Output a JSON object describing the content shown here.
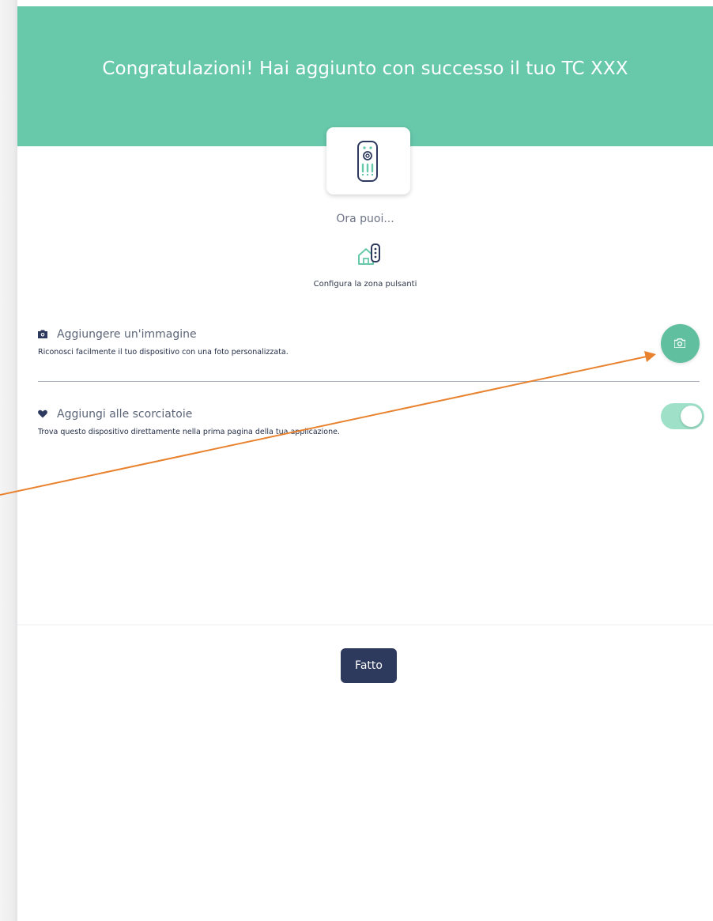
{
  "header": {
    "title": "Congratulazioni! Hai aggiunto con successo il tuo TC XXX",
    "background_color": "#67c8aa"
  },
  "device": {
    "icon": "remote-control-icon"
  },
  "intro": {
    "subtitle": "Ora puoi...",
    "feature_icon": "home-remote-icon",
    "feature_label": "Configura la zona pulsanti"
  },
  "image_section": {
    "icon": "camera-icon",
    "title": "Aggiungere un'immagine",
    "description": "Riconosci facilmente il tuo dispositivo con una foto personalizzata.",
    "action_icon": "camera-icon"
  },
  "shortcut_section": {
    "icon": "heart-icon",
    "title": "Aggiungi alle scorciatoie",
    "description": "Trova questo dispositivo direttamente nella prima pagina della tua applicazione.",
    "toggle_on": true
  },
  "footer": {
    "done_label": "Fatto",
    "button_color": "#2d3a5e"
  },
  "annotation": {
    "arrow_color": "#e8822e"
  }
}
